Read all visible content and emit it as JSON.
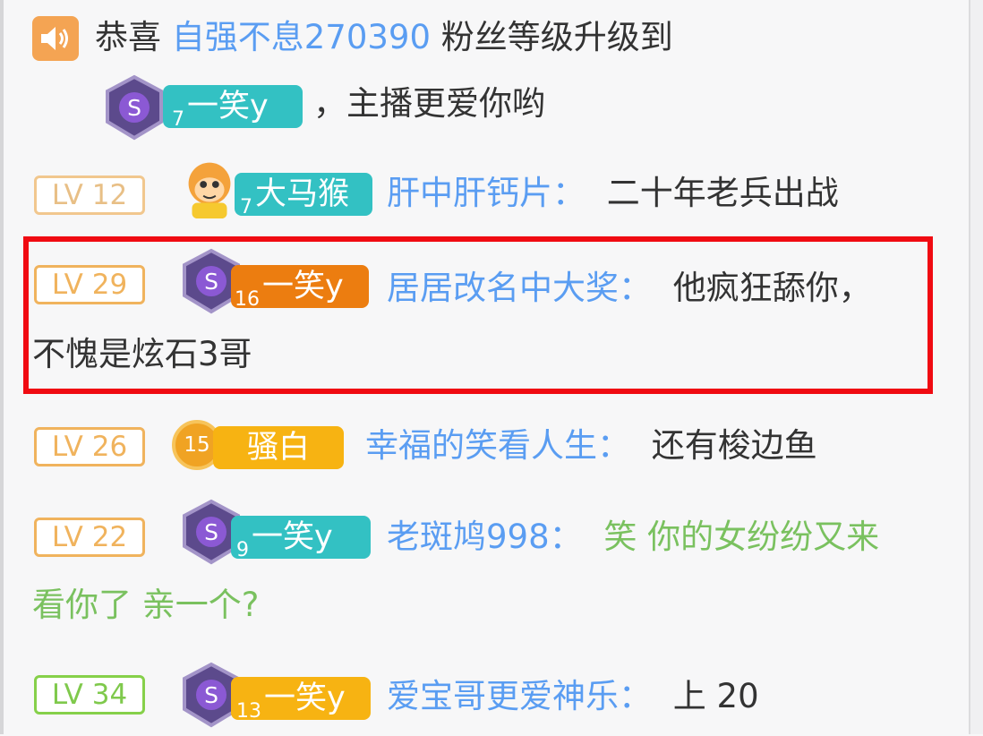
{
  "announcement": {
    "prefix": "恭喜",
    "user": "自强不息270390",
    "middle": "粉丝等级升级到",
    "badge_level": "7",
    "badge_text": "一笑y",
    "suffix": "，主播更爱你哟"
  },
  "messages": [
    {
      "level": "LV 12",
      "badge_level": "7",
      "badge_text": "大马猴",
      "user": "肝中肝钙片：",
      "text": "二十年老兵出战"
    },
    {
      "level": "LV 29",
      "badge_level": "16",
      "badge_text": "一笑y",
      "user": "居居改名中大奖：",
      "text": "他疯狂舔你，",
      "text_line2": "不愧是炫石3哥",
      "highlighted": true
    },
    {
      "level": "LV 26",
      "badge_level": "15",
      "badge_text": "骚白",
      "user": "幸福的笑看人生：",
      "text": "还有梭边鱼"
    },
    {
      "level": "LV 22",
      "badge_level": "9",
      "badge_text": "一笑y",
      "user": "老斑鸠998：",
      "text": "笑  你的女纷纷又来",
      "text_line2": "看你了  亲一个?"
    },
    {
      "level": "LV 34",
      "badge_level": "13",
      "badge_text": "一笑y",
      "user": "爱宝哥更爱神乐：",
      "text": "上 20"
    }
  ],
  "colors": {
    "username": "#5a9df2",
    "highlight": "#f00b12",
    "teal_badge": "#33c1c3",
    "orange_badge": "#ec7d10",
    "gold_badge": "#f7b312"
  },
  "icons": [
    "speaker-icon",
    "emblem-icon",
    "monkey-avatar-icon",
    "coin-icon"
  ]
}
